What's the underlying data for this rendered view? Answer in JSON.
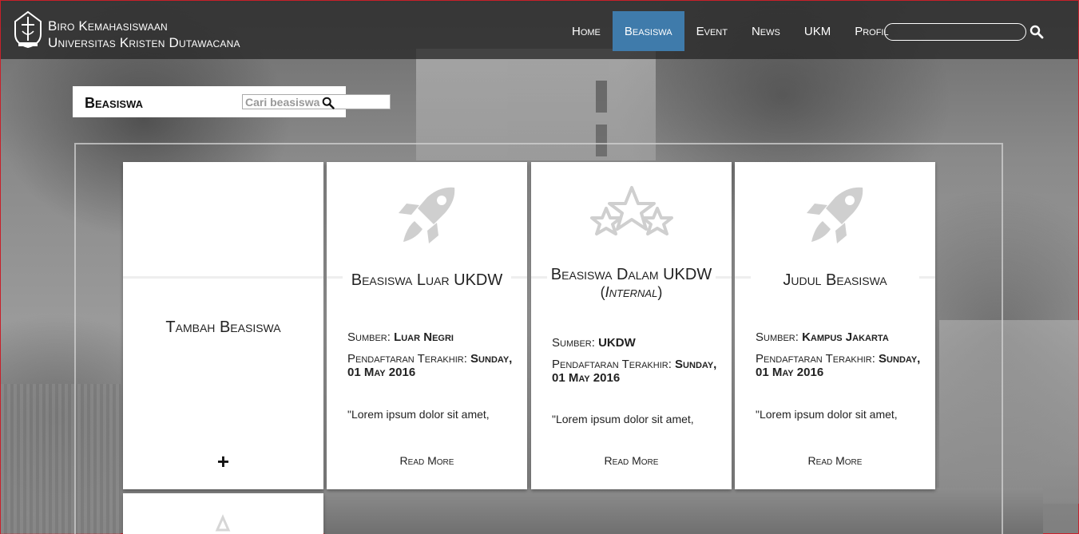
{
  "brand": {
    "line1": "Biro Kemahasiswaan",
    "line2": "Universitas Kristen Dutawacana",
    "logo_icon": "ukdw-shield-logo-icon"
  },
  "nav": {
    "items": [
      {
        "label": "Home",
        "active": false
      },
      {
        "label": "Beasiswa",
        "active": true
      },
      {
        "label": "Event",
        "active": false
      },
      {
        "label": "News",
        "active": false
      },
      {
        "label": "UKM",
        "active": false
      },
      {
        "label": "Profil",
        "active": false
      }
    ],
    "search_value": "",
    "search_icon": "search-icon",
    "active_color": "#3f7bab"
  },
  "page": {
    "title": "Beasiswa",
    "search_placeholder": "Cari beasiswa",
    "search_icon": "search-icon"
  },
  "add_card": {
    "label": "Tambah Beasiswa",
    "plus": "+"
  },
  "cards": [
    {
      "icon": "rocket-icon",
      "title": "Beasiswa Luar UKDW",
      "title_suffix": "",
      "sumber_label": "Sumber:",
      "sumber": "Luar Negri",
      "deadline_label": "Pendaftaran Terakhir:",
      "deadline": "Sunday, 01 May 2016",
      "excerpt": "\"Lorem ipsum dolor sit amet,",
      "read_more": "Read More"
    },
    {
      "icon": "stars-icon",
      "title": "Beasiswa Dalam UKDW",
      "title_suffix": "Internal",
      "sumber_label": "Sumber:",
      "sumber": "UKDW",
      "deadline_label": "Pendaftaran Terakhir:",
      "deadline": "Sunday, 01 May 2016",
      "excerpt": "\"Lorem ipsum dolor sit amet,",
      "read_more": "Read More"
    },
    {
      "icon": "rocket-icon",
      "title": "Judul Beasiswa",
      "title_suffix": "",
      "sumber_label": "Sumber:",
      "sumber": "Kampus Jakarta",
      "deadline_label": "Pendaftaran Terakhir:",
      "deadline": "Sunday, 01 May 2016",
      "excerpt": "\"Lorem ipsum dolor sit amet,",
      "read_more": "Read More"
    }
  ]
}
